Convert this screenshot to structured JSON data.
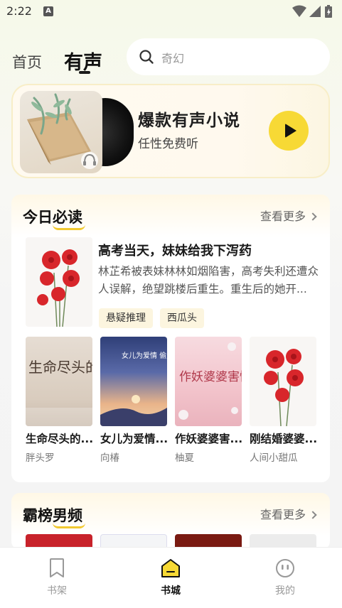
{
  "status_bar": {
    "time": "2:22",
    "notification_glyph": "A"
  },
  "header": {
    "tabs": [
      {
        "label": "首页",
        "active": false
      },
      {
        "label": "有声",
        "active": true
      }
    ],
    "search": {
      "placeholder": "奇幻",
      "icon": "search-icon"
    }
  },
  "banner": {
    "title": "爆款有声小说",
    "subtitle": "任性免费听",
    "play_icon": "play-icon",
    "accent": "#f7d935"
  },
  "today_section": {
    "title": "今日必读",
    "more_label": "查看更多",
    "featured": {
      "title": "高考当天，妹妹给我下泻药",
      "description": "林芷希被表妹林林如烟陷害，高考失利还遭众人误解，绝望跳楼后重生。重生后的她开...",
      "tags": [
        "悬疑推理",
        "西瓜头"
      ]
    },
    "books": [
      {
        "title": "生命尽头的...",
        "author": "胖头罗",
        "cover_text": "生命尽头的爱人"
      },
      {
        "title": "女儿为爱情...",
        "author": "向椿",
        "cover_text": "女儿为爱情 偷走我的救命钱"
      },
      {
        "title": "作妖婆婆害...",
        "author": "柚夏",
        "cover_text": "作妖婆婆害惨全家"
      },
      {
        "title": "刚结婚婆婆...",
        "author": "人间小甜瓜",
        "cover_text": ""
      }
    ]
  },
  "rank_section": {
    "title": "霸榜男频",
    "more_label": "查看更多"
  },
  "bottom_nav": {
    "items": [
      {
        "label": "书架",
        "icon": "bookmark-icon",
        "active": false
      },
      {
        "label": "书城",
        "icon": "store-icon",
        "active": true
      },
      {
        "label": "我的",
        "icon": "face-icon",
        "active": false
      }
    ]
  }
}
